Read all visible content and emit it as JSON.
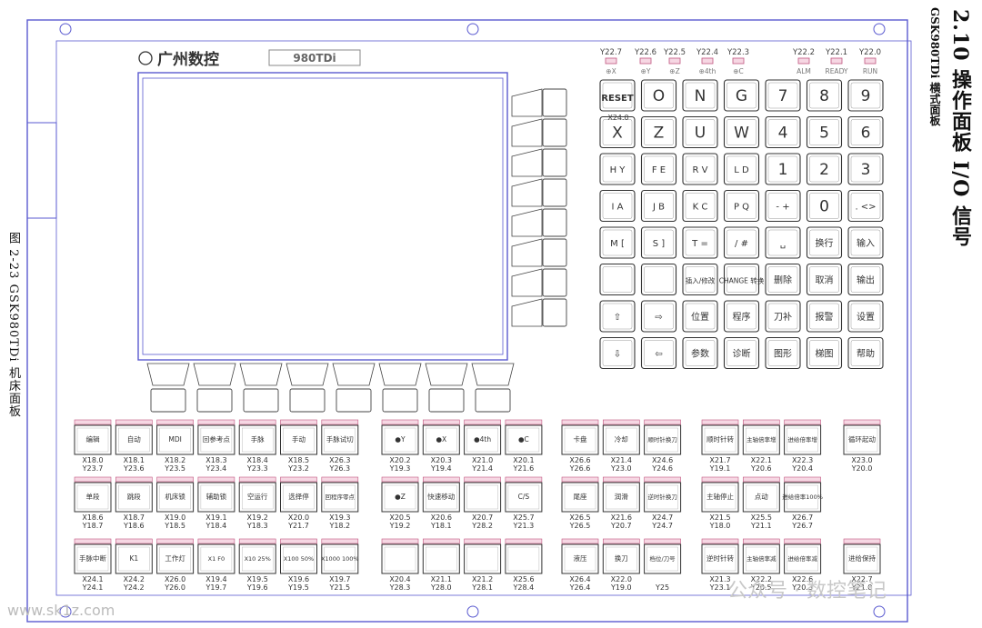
{
  "section_title": "2.10 操作面板 I/O 信号",
  "section_subtitle": "GSK980TDi 横式面板",
  "figure_caption": "图 2-23 GSK980TDi 机床面板",
  "brand": {
    "cn": "广州数控",
    "model": "980TDi"
  },
  "watermark_left": "www.sk1z.com",
  "watermark_right": "公众号 · 数控笔记",
  "leds": [
    {
      "code": "Y22.7",
      "label": "⊕X"
    },
    {
      "code": "Y22.6",
      "label": "⊕Y"
    },
    {
      "code": "Y22.5",
      "label": "⊕Z"
    },
    {
      "code": "Y22.4",
      "label": "⊕4th"
    },
    {
      "code": "Y22.3",
      "label": "⊕C"
    },
    {
      "code": "Y22.2",
      "label": "ALM"
    },
    {
      "code": "Y22.1",
      "label": "READY"
    },
    {
      "code": "Y22.0",
      "label": "RUN"
    }
  ],
  "reset_code": "X24.0",
  "keypad": [
    [
      "RESET",
      "O",
      "N",
      "G",
      "7",
      "8",
      "9"
    ],
    [
      "X",
      "Z",
      "U",
      "W",
      "4",
      "5",
      "6"
    ],
    [
      "H Y",
      "F E",
      "R V",
      "L D",
      "1",
      "2",
      "3"
    ],
    [
      "I A",
      "J B",
      "K C",
      "P Q",
      "- +",
      "0",
      ". <>"
    ],
    [
      "M [",
      "S ]",
      "T =",
      "/ #",
      "␣",
      "换行",
      "输入"
    ],
    [
      "",
      "",
      "插入/修改",
      "CHANGE 转换",
      "删除",
      "取消",
      "输出"
    ],
    [
      "⇧",
      "⇨",
      "位置",
      "程序",
      "刀补",
      "报警",
      "设置"
    ],
    [
      "⇩",
      "⇦",
      "参数",
      "诊断",
      "图形",
      "梯图",
      "帮助"
    ]
  ],
  "function_keys": [
    {
      "label": "编辑",
      "x": "X18.0",
      "y": "Y23.7"
    },
    {
      "label": "自动",
      "x": "X18.1",
      "y": "Y23.6"
    },
    {
      "label": "MDI",
      "x": "X18.2",
      "y": "Y23.5"
    },
    {
      "label": "回参考点",
      "x": "X18.3",
      "y": "Y23.4"
    },
    {
      "label": "手脉",
      "x": "X18.4",
      "y": "Y23.3"
    },
    {
      "label": "手动",
      "x": "X18.5",
      "y": "Y23.2"
    },
    {
      "label": "手脉试切",
      "x": "X26.3",
      "y": "Y26.3"
    },
    {
      "label": "●Y",
      "x": "X20.2",
      "y": "Y19.3"
    },
    {
      "label": "●X",
      "x": "X20.3",
      "y": "Y19.4"
    },
    {
      "label": "●4th",
      "x": "X21.0",
      "y": "Y21.4"
    },
    {
      "label": "●C",
      "x": "X20.1",
      "y": "Y21.6"
    },
    {
      "label": "卡盘",
      "x": "X26.6",
      "y": "Y26.6"
    },
    {
      "label": "冷却",
      "x": "X21.4",
      "y": "Y23.0"
    },
    {
      "label": "顺时针换刀",
      "x": "X24.6",
      "y": "Y24.6"
    },
    {
      "label": "顺时针转",
      "x": "X21.7",
      "y": "Y19.1"
    },
    {
      "label": "主轴倍率增",
      "x": "X22.1",
      "y": "Y20.6"
    },
    {
      "label": "进给倍率增",
      "x": "X22.3",
      "y": "Y20.4"
    },
    {
      "label": "循环起动",
      "x": "X23.0",
      "y": "Y20.0"
    },
    {
      "label": "单段",
      "x": "X18.6",
      "y": "Y18.7"
    },
    {
      "label": "跳段",
      "x": "X18.7",
      "y": "Y18.6"
    },
    {
      "label": "机床锁",
      "x": "X19.0",
      "y": "Y18.5"
    },
    {
      "label": "辅助锁",
      "x": "X19.1",
      "y": "Y18.4"
    },
    {
      "label": "空运行",
      "x": "X19.2",
      "y": "Y18.3"
    },
    {
      "label": "选择停",
      "x": "X20.0",
      "y": "Y21.7"
    },
    {
      "label": "回程序零点",
      "x": "X19.3",
      "y": "Y18.2"
    },
    {
      "label": "●Z",
      "x": "X20.5",
      "y": "Y19.2"
    },
    {
      "label": "快速移动",
      "x": "X20.6",
      "y": "Y18.1"
    },
    {
      "label": "",
      "x": "X20.7",
      "y": "Y28.2"
    },
    {
      "label": "C/S",
      "x": "X25.7",
      "y": "Y21.3"
    },
    {
      "label": "尾座",
      "x": "X26.5",
      "y": "Y26.5"
    },
    {
      "label": "润滑",
      "x": "X21.6",
      "y": "Y20.7"
    },
    {
      "label": "逆时针换刀",
      "x": "X24.7",
      "y": "Y24.7"
    },
    {
      "label": "主轴停止",
      "x": "X21.5",
      "y": "Y18.0"
    },
    {
      "label": "点动",
      "x": "X25.5",
      "y": "Y21.1"
    },
    {
      "label": "进给倍率100%",
      "x": "X26.7",
      "y": "Y26.7"
    },
    {
      "label": "手脉中断",
      "x": "X24.1",
      "y": "Y24.1"
    },
    {
      "label": "K1",
      "x": "X24.2",
      "y": "Y24.2"
    },
    {
      "label": "工作灯",
      "x": "X26.0",
      "y": "Y26.0"
    },
    {
      "label": "X1 F0",
      "x": "X19.4",
      "y": "Y19.7"
    },
    {
      "label": "X10 25%",
      "x": "X19.5",
      "y": "Y19.6"
    },
    {
      "label": "X100 50%",
      "x": "X19.6",
      "y": "Y19.5"
    },
    {
      "label": "X1000 100%",
      "x": "X19.7",
      "y": "Y21.5"
    },
    {
      "label": "",
      "x": "X20.4",
      "y": "Y28.3"
    },
    {
      "label": "",
      "x": "X21.1",
      "y": "Y28.0"
    },
    {
      "label": "",
      "x": "X21.2",
      "y": "Y28.1"
    },
    {
      "label": "",
      "x": "X25.6",
      "y": "Y28.4"
    },
    {
      "label": "液压",
      "x": "X26.4",
      "y": "Y26.4"
    },
    {
      "label": "换刀",
      "x": "X22.0",
      "y": "Y19.0"
    },
    {
      "label": "档位/刀号",
      "x": "",
      "y": "Y25"
    },
    {
      "label": "逆时针转",
      "x": "X21.3",
      "y": "Y23.1"
    },
    {
      "label": "主轴倍率减",
      "x": "X22.2",
      "y": "Y20.5"
    },
    {
      "label": "进给倍率减",
      "x": "X22.6",
      "y": "Y20.3"
    },
    {
      "label": "进给保持",
      "x": "X22.7",
      "y": "Y21.0"
    }
  ]
}
